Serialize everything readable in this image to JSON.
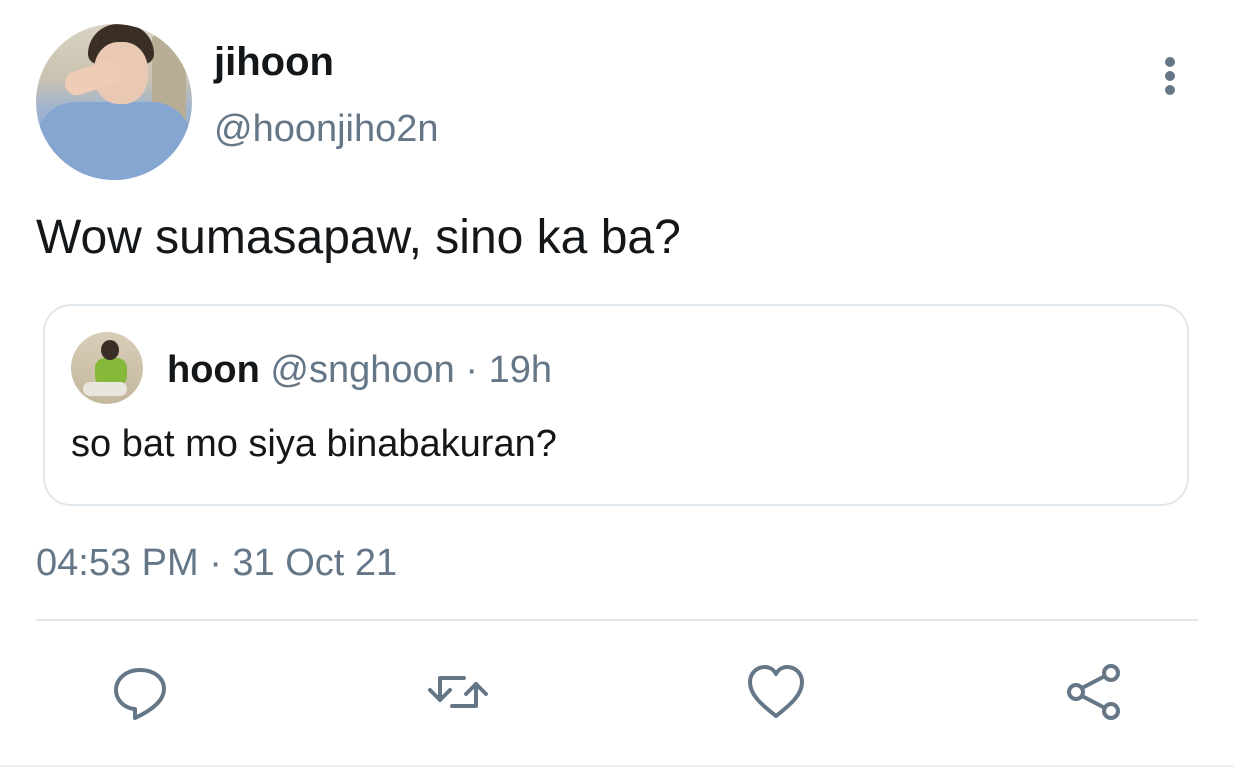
{
  "tweet": {
    "author": {
      "display_name": "jihoon",
      "handle": "@hoonjiho2n",
      "avatar": "avatar"
    },
    "text": "Wow sumasapaw, sino ka ba?",
    "timestamp": "04:53 PM · 31 Oct 21",
    "more_icon": "more-vertical-icon"
  },
  "quote": {
    "display_name": "hoon",
    "handle": "@snghoon",
    "separator": "·",
    "time": "19h",
    "text": "so bat mo siya binabakuran?"
  },
  "actions": [
    {
      "name": "reply",
      "icon": "reply-icon"
    },
    {
      "name": "retweet",
      "icon": "retweet-icon"
    },
    {
      "name": "like",
      "icon": "heart-icon"
    },
    {
      "name": "share",
      "icon": "share-icon"
    }
  ],
  "colors": {
    "primary_text": "#14171a",
    "secondary_text": "#657786",
    "border": "#e1e8ed"
  }
}
